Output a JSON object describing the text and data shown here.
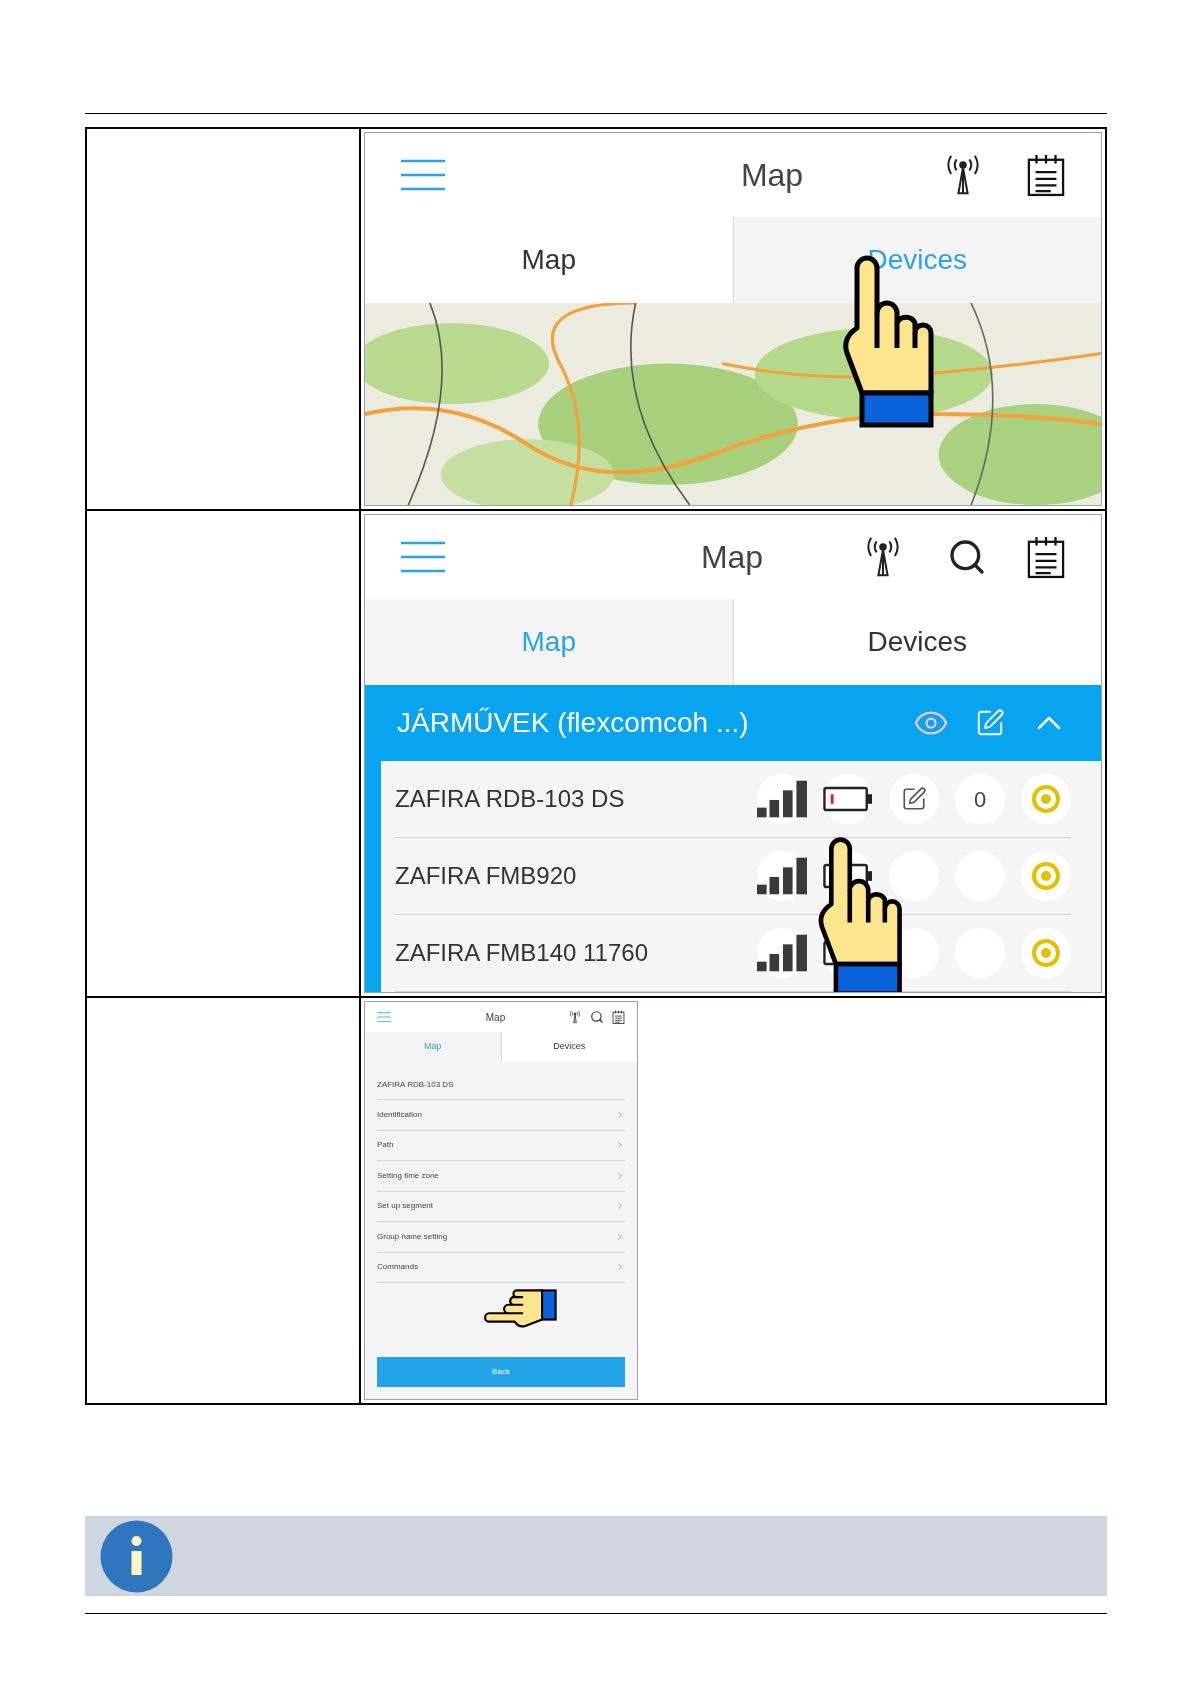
{
  "steps": [
    {
      "screen": {
        "title": "Map",
        "show_search": false,
        "tabs": [
          {
            "label": "Map",
            "selected": false
          },
          {
            "label": "Devices",
            "selected": true
          }
        ],
        "body": {
          "kind": "map"
        }
      }
    },
    {
      "screen": {
        "title": "Map",
        "show_search": true,
        "tabs": [
          {
            "label": "Map",
            "selected": true
          },
          {
            "label": "Devices",
            "selected": false
          }
        ],
        "body": {
          "kind": "device_list",
          "group_title": "JÁRMŰVEK (flexcomcoh ...)",
          "devices": [
            {
              "name": "ZAFIRA RDB-103 DS",
              "count": "0"
            },
            {
              "name": "ZAFIRA FMB920"
            },
            {
              "name": "ZAFIRA FMB140 11760"
            }
          ]
        }
      }
    },
    {
      "screen": {
        "title": "Map",
        "show_search": true,
        "tabs": [
          {
            "label": "Map",
            "selected": true
          },
          {
            "label": "Devices",
            "selected": false
          }
        ],
        "body": {
          "kind": "device_menu",
          "device": "ZAFIRA RDB-103 DS",
          "items": [
            "Identification",
            "Path",
            "Setting time zone",
            "Set up segment",
            "Group name setting",
            "Commands"
          ],
          "button": "Back"
        }
      }
    }
  ]
}
